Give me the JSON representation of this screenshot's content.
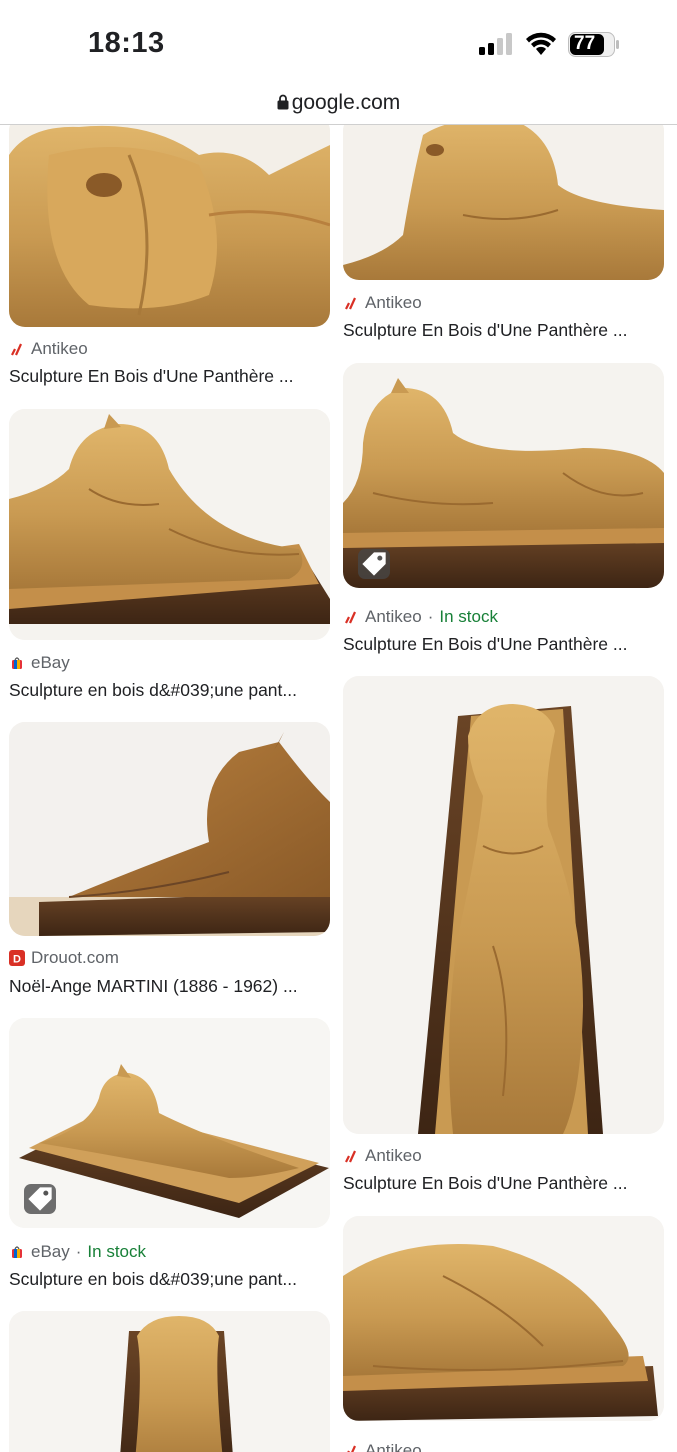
{
  "status": {
    "time": "18:13",
    "battery": "77"
  },
  "browser": {
    "url": "google.com"
  },
  "results": {
    "left": [
      {
        "source": "Antikeo",
        "stock": "",
        "title": "Sculpture En Bois d'Une Panthère ..."
      },
      {
        "source": "eBay",
        "stock": "",
        "title": "Sculpture en bois d&#039;une pant..."
      },
      {
        "source": "Drouot.com",
        "stock": "",
        "title": "Noël-Ange MARTINI (1886 - 1962) ..."
      },
      {
        "source": "eBay",
        "stock": "In stock",
        "title": "Sculpture en bois d&#039;une pant..."
      }
    ],
    "right": [
      {
        "source": "Antikeo",
        "stock": "",
        "title": "Sculpture En Bois d'Une Panthère ..."
      },
      {
        "source": "Antikeo",
        "stock": "In stock",
        "title": "Sculpture En Bois d'Une Panthère ..."
      },
      {
        "source": "Antikeo",
        "stock": "",
        "title": "Sculpture En Bois d'Une Panthère ..."
      },
      {
        "source": "Antikeo",
        "stock": "",
        "title": ""
      }
    ]
  },
  "separator": "·",
  "colors": {
    "in_stock": "#188038",
    "wood": "#c99a52",
    "plinth": "#5a3a22"
  },
  "icons": [
    "lock-icon",
    "shopping-tag-icon",
    "antikeo-logo-icon",
    "ebay-logo-icon",
    "drouot-logo-icon"
  ]
}
